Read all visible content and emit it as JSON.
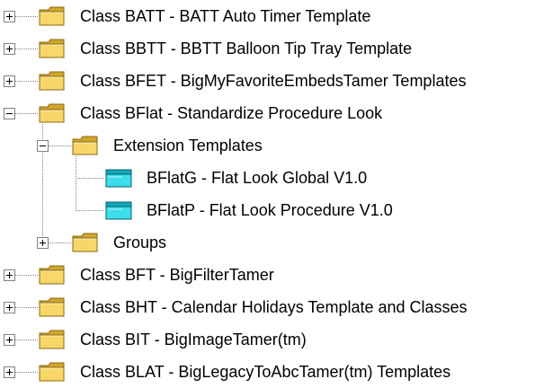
{
  "tree": {
    "nodes": [
      {
        "label": "Class BATT - BATT Auto Timer Template",
        "level": 0,
        "icon": "folder-icon",
        "expander": "plus"
      },
      {
        "label": "Class BBTT - BBTT Balloon Tip Tray Template",
        "level": 0,
        "icon": "folder-icon",
        "expander": "plus"
      },
      {
        "label": "Class BFET - BigMyFavoriteEmbedsTamer Templates",
        "level": 0,
        "icon": "folder-icon",
        "expander": "plus"
      },
      {
        "label": "Class BFlat - Standardize Procedure Look",
        "level": 0,
        "icon": "folder-open-icon",
        "expander": "minus"
      },
      {
        "label": "Extension Templates",
        "level": 1,
        "icon": "folder-open-icon",
        "expander": "minus"
      },
      {
        "label": "BFlatG - Flat Look Global V1.0",
        "level": 2,
        "icon": "template-icon",
        "expander": "none"
      },
      {
        "label": "BFlatP - Flat Look Procedure V1.0",
        "level": 2,
        "icon": "template-icon",
        "expander": "none"
      },
      {
        "label": "Groups",
        "level": 1,
        "icon": "folder-icon",
        "expander": "plus"
      },
      {
        "label": "Class BFT - BigFilterTamer",
        "level": 0,
        "icon": "folder-icon",
        "expander": "plus"
      },
      {
        "label": "Class BHT - Calendar Holidays Template and Classes",
        "level": 0,
        "icon": "folder-icon",
        "expander": "plus"
      },
      {
        "label": "Class BIT - BigImageTamer(tm)",
        "level": 0,
        "icon": "folder-icon",
        "expander": "plus"
      },
      {
        "label": "Class BLAT - BigLegacyToAbcTamer(tm) Templates",
        "level": 0,
        "icon": "folder-icon",
        "expander": "plus"
      }
    ]
  },
  "colors": {
    "folder_fill": "#F8D668",
    "folder_dark": "#D2A62C",
    "folder_outline": "#8A6A12",
    "template_fill": "#3DDDEB",
    "template_dark": "#12A8B8",
    "template_outline": "#0B5E6E",
    "connector": "#808080",
    "expander_border": "#808080"
  }
}
